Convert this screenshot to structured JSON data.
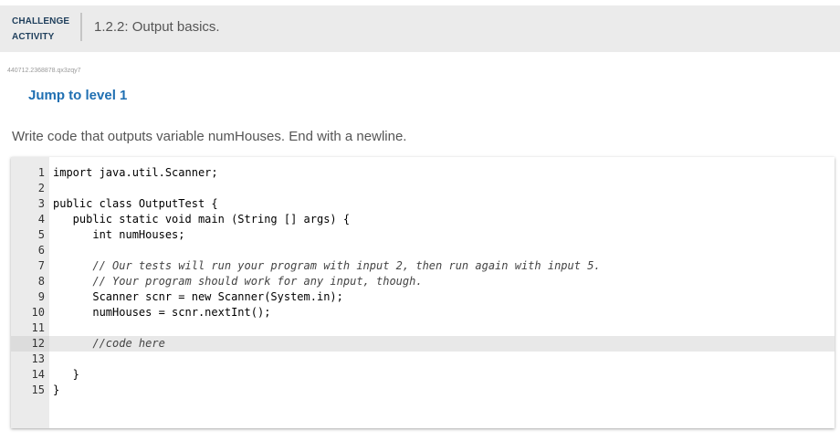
{
  "header": {
    "badge_line1": "CHALLENGE",
    "badge_line2": "ACTIVITY",
    "title": "1.2.2: Output basics."
  },
  "activity_id": "440712.2368878.qx3zqy7",
  "jump_link": "Jump to level 1",
  "prompt": "Write code that outputs variable numHouses. End with a newline.",
  "editor": {
    "active_line": 12,
    "lines": [
      {
        "n": "1",
        "text": "import java.util.Scanner;"
      },
      {
        "n": "2",
        "text": ""
      },
      {
        "n": "3",
        "text": "public class OutputTest {"
      },
      {
        "n": "4",
        "text": "   public static void main (String [] args) {"
      },
      {
        "n": "5",
        "text": "      int numHouses;"
      },
      {
        "n": "6",
        "text": ""
      },
      {
        "n": "7",
        "text": "      // Our tests will run your program with input 2, then run again with input 5."
      },
      {
        "n": "8",
        "text": "      // Your program should work for any input, though."
      },
      {
        "n": "9",
        "text": "      Scanner scnr = new Scanner(System.in);"
      },
      {
        "n": "10",
        "text": "      numHouses = scnr.nextInt();"
      },
      {
        "n": "11",
        "text": ""
      },
      {
        "n": "12",
        "text": "      //code here"
      },
      {
        "n": "13",
        "text": ""
      },
      {
        "n": "14",
        "text": "   }"
      },
      {
        "n": "15",
        "text": "}"
      }
    ]
  }
}
